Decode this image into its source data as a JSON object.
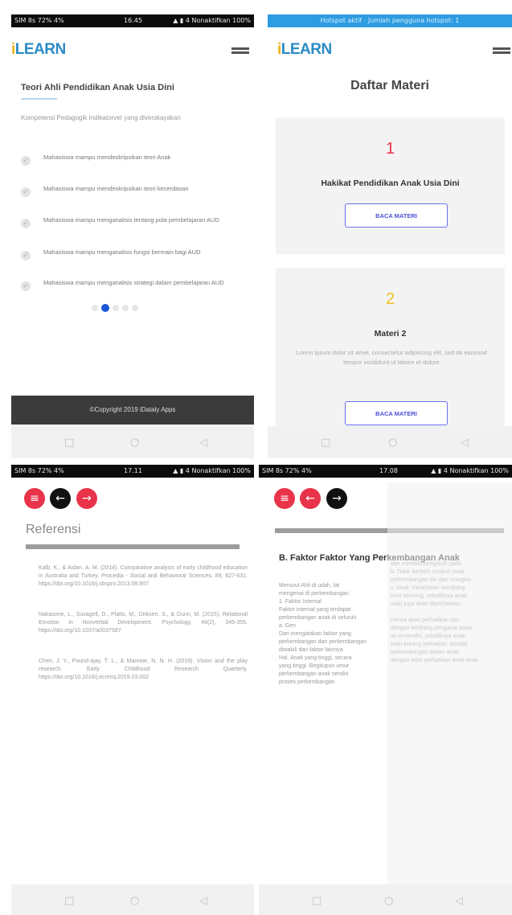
{
  "panel1": {
    "status": {
      "left": "SIM 8s 72% 4%",
      "center": "16.45",
      "right": "▲ ▮ 4 Nonaktifkan 100%"
    },
    "logo": "iLEARN",
    "title": "Teori Ahli Pendidikan Anak Usia Dini",
    "subtitle": "Kompetensi Pedagogik Indikatorvet yang diverskayakan",
    "items": [
      "Mahasiswa mampu mendeskripsikan teori Anak",
      "Mahasiswa mampu mendeskripsikan teori kecerdasan",
      "Mahasiswa mampu menganalisis tentang pola pembelajaran AUD",
      "Mahasiswa mampu menganalisis fungsi bermain bagi AUD",
      "Mahasiswa mampu menganalisis strategi dalam pembelajaran AUD"
    ],
    "footer": "©Copyright 2019 iDataly Apps",
    "nav": [
      "□",
      "○",
      "◁"
    ]
  },
  "panel2": {
    "status": "Hotspot aktif · Jumlah pengguna hotspot: 1",
    "logo": "iLEARN",
    "heading": "Daftar Materi",
    "cards": [
      {
        "number": "1",
        "title": "Hakikat Pendidikan Anak Usia Dini",
        "button": "BACA MATERI"
      },
      {
        "number": "2",
        "title": "Materi 2",
        "description": "Lorem ipsum dolor sit amet, consectetur adipiscing elit, sed do eiusmod tempor incididunt ut labore et dolore",
        "button": "BACA MATERI"
      }
    ],
    "nav": [
      "□",
      "○",
      "◁"
    ]
  },
  "panel3": {
    "status": {
      "left": "SIM 8s 72% 4%",
      "center": "17.11",
      "right": "▲ ▮ 4 Nonaktifkan 100%"
    },
    "title": "Referensi",
    "references": [
      "Kalb, K., & Aidan, A. M. (2014). Comparative analysis of early childhood education in Australia and Turkey. Procedia - Social and Behavioral Sciences, 89, 627-631. https://doi.org/10.1016/j.sbspro.2013.08.907",
      "Nakasone, L., Suvagell, D., Platts, M., Dirksen, S., & Dunn, M. (2015). Relational Emotion in Nonverbal Development. Psychology, 46(2), 345-355. https://doi.org/10.1037/a0037587",
      "Chen, J. Y., Pound-ajay, T. L., & Mannoe, N. N. H. (2019). Vision and the play research. Early Childhood Research Quarterly. https://doi.org/10.1016/j.ecresq.2019.03.002"
    ],
    "nav": [
      "□",
      "○",
      "◁"
    ]
  },
  "panel4": {
    "status": {
      "left": "SIM 8s 72% 4%",
      "center": "17.08",
      "right": "▲ ▮ 4 Nonaktifkan 100%"
    },
    "title": "B. Faktor Faktor Yang Perkembangan Anak",
    "left_lines": [
      "Menurut Ahli di udah, lat",
      "mengenai di perkembangan",
      "1. Faktor Internal",
      "Faktor internal yang terdapat",
      "perkembangan anak di seluruh",
      "a. Gen",
      "Dari mengatakan faktor yang",
      "perkembangan dan perkembangan",
      "diwakili dari faktor lainnya",
      "Hal. Anak yang tinggi, secara",
      "yang tinggi. Begitupun umur",
      "perkembangan anak sendiri",
      "proses perkembangan"
    ],
    "right_lines": [
      "dan memiliki pengaruh pada",
      "b. Tidak berlatih tumbuh anak",
      "perkembangan diri dan mungkin",
      "c. Anak. Kesehatan seimbang",
      "kurir seorang, sebaliknya anak",
      "sakit juga akan diperhatikan.",
      "",
      "Hanya akan perhatikan dan",
      "dengan lembang pengaruh pada",
      "an tersendiri, sebaliknya anak",
      "yaitu kurang perhatian, diambil",
      "perkembangan dalam anak",
      "dengan lebih perhatikan anak-anak"
    ],
    "nav": [
      "□",
      "○",
      "◁"
    ]
  },
  "colors": {
    "blue_logo": "#2a8cc6",
    "red_button": "#e8334a",
    "number1": "#e8334a",
    "number2": "#f0c020",
    "button_border": "#6b6ff0"
  }
}
